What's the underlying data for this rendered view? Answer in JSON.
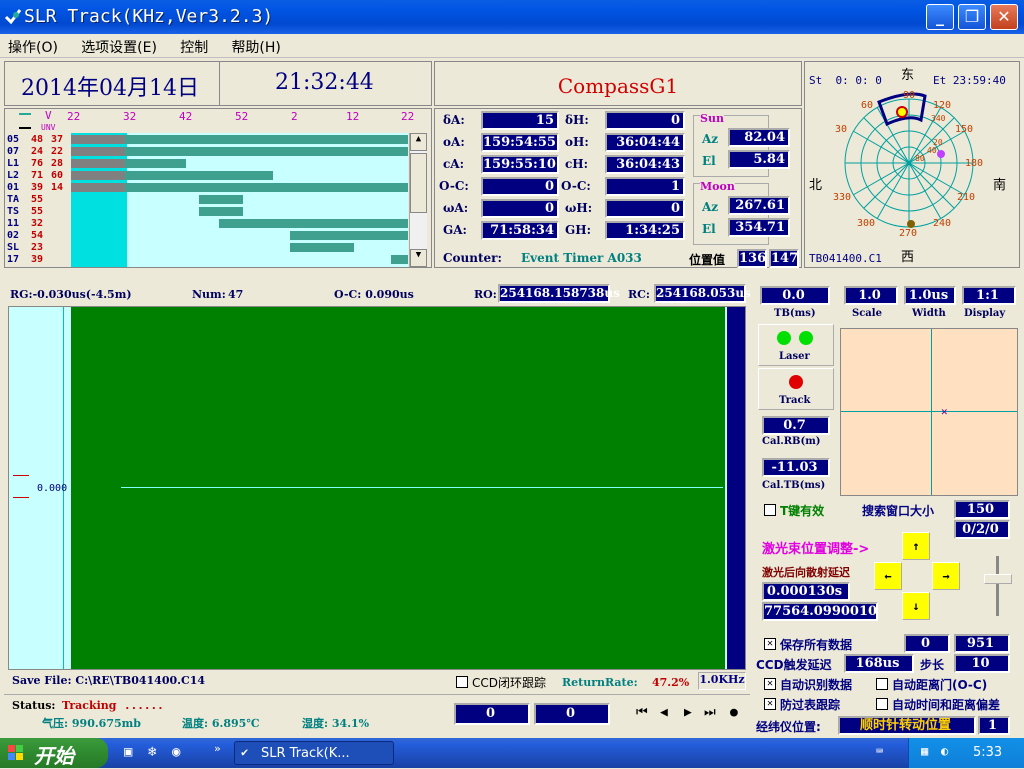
{
  "window": {
    "title": "SLR Track(KHz,Ver3.2.3)"
  },
  "menu": [
    "操作(O)",
    "选项设置(E)",
    "控制",
    "帮助(H)"
  ],
  "header": {
    "date": "2014年04月14日",
    "time": "21:32:44",
    "satellite": "CompassG1"
  },
  "pass_chart": {
    "v_label": "V",
    "unv_label": "UNV",
    "x_ticks": [
      "22",
      "32",
      "42",
      "52",
      "2",
      "12",
      "22"
    ],
    "rows": [
      {
        "name": "05",
        "a": "48",
        "b": "37",
        "color": "#c00000",
        "bar": [
          0,
          1.0
        ],
        "gray": [
          0,
          0.16
        ]
      },
      {
        "name": "07",
        "a": "24",
        "b": "22",
        "color": "#c00000",
        "bar": [
          0,
          1.0
        ],
        "gray": [
          0,
          0.16
        ]
      },
      {
        "name": "L1",
        "a": "76",
        "b": "28",
        "color": "#c00000",
        "bar": [
          0,
          0.34
        ],
        "gray": [
          0,
          0.16
        ]
      },
      {
        "name": "L2",
        "a": "71",
        "b": "60",
        "color": "#c00000",
        "bar": [
          0,
          0.6
        ],
        "gray": [
          0,
          0.16
        ]
      },
      {
        "name": "01",
        "a": "39",
        "b": "14",
        "color": "#c00000",
        "bar": [
          0,
          1.0
        ],
        "gray": [
          0,
          0.16
        ]
      },
      {
        "name": "TA",
        "a": "55",
        "b": "",
        "color": "#c00000",
        "bar": [
          0.38,
          0.51
        ],
        "gray": null
      },
      {
        "name": "TS",
        "a": "55",
        "b": "",
        "color": "#c00000",
        "bar": [
          0.38,
          0.51
        ],
        "gray": null
      },
      {
        "name": "11",
        "a": "32",
        "b": "",
        "color": "#c00000",
        "bar": [
          0.44,
          1.0
        ],
        "gray": null
      },
      {
        "name": "02",
        "a": "54",
        "b": "",
        "color": "#c00000",
        "bar": [
          0.65,
          1.0
        ],
        "gray": null
      },
      {
        "name": "SL",
        "a": "23",
        "b": "",
        "color": "#c00000",
        "bar": [
          0.65,
          0.84
        ],
        "gray": null
      },
      {
        "name": "17",
        "a": "39",
        "b": "",
        "color": "#c00000",
        "bar": [
          0.95,
          1.0
        ],
        "gray": null
      }
    ]
  },
  "params": {
    "dA_label": "δA:",
    "dA": "15",
    "dH_label": "δH:",
    "dH": "0",
    "oA_label": "oA:",
    "oA": "159:54:55",
    "oH_label": "oH:",
    "oH": "36:04:44",
    "cA_label": "cA:",
    "cA": "159:55:10",
    "cH_label": "cH:",
    "cH": "36:04:43",
    "ocA_label": "O-C:",
    "ocA": "0",
    "ocH_label": "O-C:",
    "ocH": "1",
    "wA_label": "ωA:",
    "wA": "0",
    "wH_label": "ωH:",
    "wH": "0",
    "GA_label": "GA:",
    "GA": "71:58:34",
    "GH_label": "GH:",
    "GH": "1:34:25",
    "sun_label": "Sun",
    "sun_az_label": "Az",
    "sun_az": "82.04",
    "sun_el_label": "El",
    "sun_el": "5.84",
    "moon_label": "Moon",
    "moon_az_label": "Az",
    "moon_az": "267.61",
    "moon_el_label": "El",
    "moon_el": "354.71",
    "counter_label": "Counter:",
    "counter_value": "Event Timer A033",
    "pos_label": "位置值",
    "pos1": "136",
    "pos2": "147"
  },
  "polar": {
    "st": "St  0: 0: 0",
    "et": "Et 23:59:40",
    "east": "东",
    "west": "西",
    "north": "北",
    "south": "南",
    "file": "TB041400.C1",
    "ticks": [
      "90",
      "120",
      "150",
      "180",
      "210",
      "240",
      "270",
      "300",
      "330",
      "30",
      "60"
    ],
    "inner": [
      "340",
      "20",
      "40",
      "80"
    ]
  },
  "status_top": {
    "rg": "RG:-0.030us(-4.5m)",
    "num_label": "Num:",
    "num": "47",
    "oc": "O-C: 0.090us",
    "ro_label": "RO:",
    "ro": "254168.158738us",
    "rc_label": "RC:",
    "rc": "254168.053us"
  },
  "plot": {
    "y_label": "0.000"
  },
  "right": {
    "tb": "0.0",
    "tb_label": "TB(ms)",
    "scale": "1.0",
    "scale_label": "Scale",
    "width": "1.0us",
    "width_label": "Width",
    "display": "1:1",
    "display_label": "Display",
    "laser_label": "Laser",
    "track_label": "Track",
    "calrb": "0.7",
    "calrb_label": "Cal.RB(m)",
    "caltb": "-11.03",
    "caltb_label": "Cal.TB(ms)"
  },
  "controls": {
    "tkey": "T键有效",
    "search_label": "搜索窗口大小",
    "search": "150",
    "search2": "0/2/0",
    "laser_adjust": "激光束位置调整->",
    "backscatter": "激光后向散射延迟",
    "bs1": "0.000130s",
    "bs2": "77564.0990010",
    "save_all": "保存所有数据",
    "sa1": "0",
    "sa2": "951",
    "ccd_delay_label": "CCD触发延迟",
    "ccd_delay": "168us",
    "step_label": "步长",
    "step": "10",
    "auto_id": "自动识别数据",
    "auto_gate": "自动距离门(O-C)",
    "anti_fg": "防过表跟踪",
    "auto_time": "自动时间和距离偏差",
    "geo_label": "经纬仪位置:",
    "geo": "顺时针转动位置",
    "geo_n": "1"
  },
  "bottom": {
    "save_file": "Save File: C:\\RE\\TB041400.C14",
    "ccd_loop": "CCD闭环跟踪",
    "return_rate_label": "ReturnRate:",
    "return_rate": "47.2%",
    "rate": "1.0KHz",
    "status_label": "Status:",
    "status": "Tracking",
    "status_dots": "......",
    "pressure": "气压: 990.675mb",
    "temp": "温度: 6.895℃",
    "humidity": "湿度: 34.1%",
    "c1": "0",
    "c2": "0"
  },
  "taskbar": {
    "start": "开始",
    "task": "SLR Track(K...",
    "clock": "5:33"
  }
}
